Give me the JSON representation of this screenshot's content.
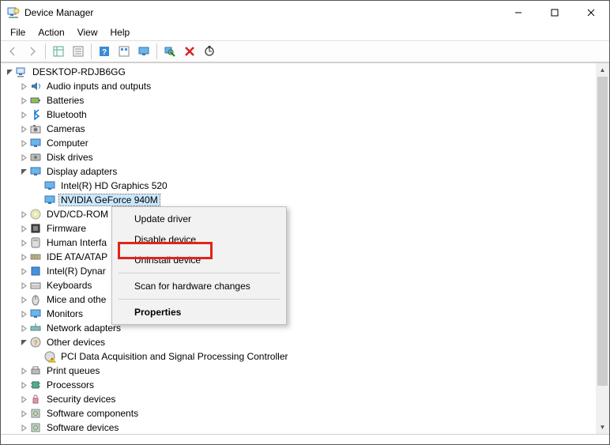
{
  "window": {
    "title": "Device Manager"
  },
  "menu": {
    "file": "File",
    "action": "Action",
    "view": "View",
    "help": "Help"
  },
  "toolbar_icons": {
    "back": "back-icon",
    "forward": "forward-icon",
    "up": "show-hide-tree-icon",
    "props": "properties-icon",
    "help": "help-icon",
    "action": "action-props-icon",
    "monitor": "show-hidden-icon",
    "scan": "scan-hardware-icon",
    "remove": "uninstall-icon",
    "update": "update-driver-icon"
  },
  "root": {
    "label": "DESKTOP-RDJB6GG",
    "children": [
      {
        "label": "Audio inputs and outputs",
        "exp": "closed",
        "icon": "audio"
      },
      {
        "label": "Batteries",
        "exp": "closed",
        "icon": "battery"
      },
      {
        "label": "Bluetooth",
        "exp": "closed",
        "icon": "bluetooth"
      },
      {
        "label": "Cameras",
        "exp": "closed",
        "icon": "camera"
      },
      {
        "label": "Computer",
        "exp": "closed",
        "icon": "computer"
      },
      {
        "label": "Disk drives",
        "exp": "closed",
        "icon": "disk"
      },
      {
        "label": "Display adapters",
        "exp": "open",
        "icon": "display",
        "children": [
          {
            "label": "Intel(R) HD Graphics 520",
            "icon": "display"
          },
          {
            "label": "NVIDIA GeForce 940M",
            "icon": "display",
            "selected": true
          }
        ]
      },
      {
        "label": "DVD/CD-ROM",
        "exp": "closed",
        "icon": "dvd",
        "trunc": true
      },
      {
        "label": "Firmware",
        "exp": "closed",
        "icon": "firmware"
      },
      {
        "label": "Human Interfa",
        "exp": "closed",
        "icon": "hid",
        "trunc": true
      },
      {
        "label": "IDE ATA/ATAP",
        "exp": "closed",
        "icon": "ide",
        "trunc": true
      },
      {
        "label": "Intel(R) Dynar",
        "exp": "closed",
        "icon": "intel",
        "trunc": true
      },
      {
        "label": "Keyboards",
        "exp": "closed",
        "icon": "keyboard"
      },
      {
        "label": "Mice and othe",
        "exp": "closed",
        "icon": "mouse",
        "trunc": true
      },
      {
        "label": "Monitors",
        "exp": "closed",
        "icon": "monitor"
      },
      {
        "label": "Network adapters",
        "exp": "closed",
        "icon": "network"
      },
      {
        "label": "Other devices",
        "exp": "open",
        "icon": "other",
        "children": [
          {
            "label": "PCI Data Acquisition and Signal Processing Controller",
            "icon": "other-warn"
          }
        ]
      },
      {
        "label": "Print queues",
        "exp": "closed",
        "icon": "printer"
      },
      {
        "label": "Processors",
        "exp": "closed",
        "icon": "cpu"
      },
      {
        "label": "Security devices",
        "exp": "closed",
        "icon": "security"
      },
      {
        "label": "Software components",
        "exp": "closed",
        "icon": "software"
      },
      {
        "label": "Software devices",
        "exp": "closed",
        "icon": "software"
      }
    ]
  },
  "context_menu": {
    "update": "Update driver",
    "disable": "Disable device",
    "uninstall": "Uninstall device",
    "scan": "Scan for hardware changes",
    "properties": "Properties"
  },
  "highlight": {
    "target": "uninstall"
  }
}
